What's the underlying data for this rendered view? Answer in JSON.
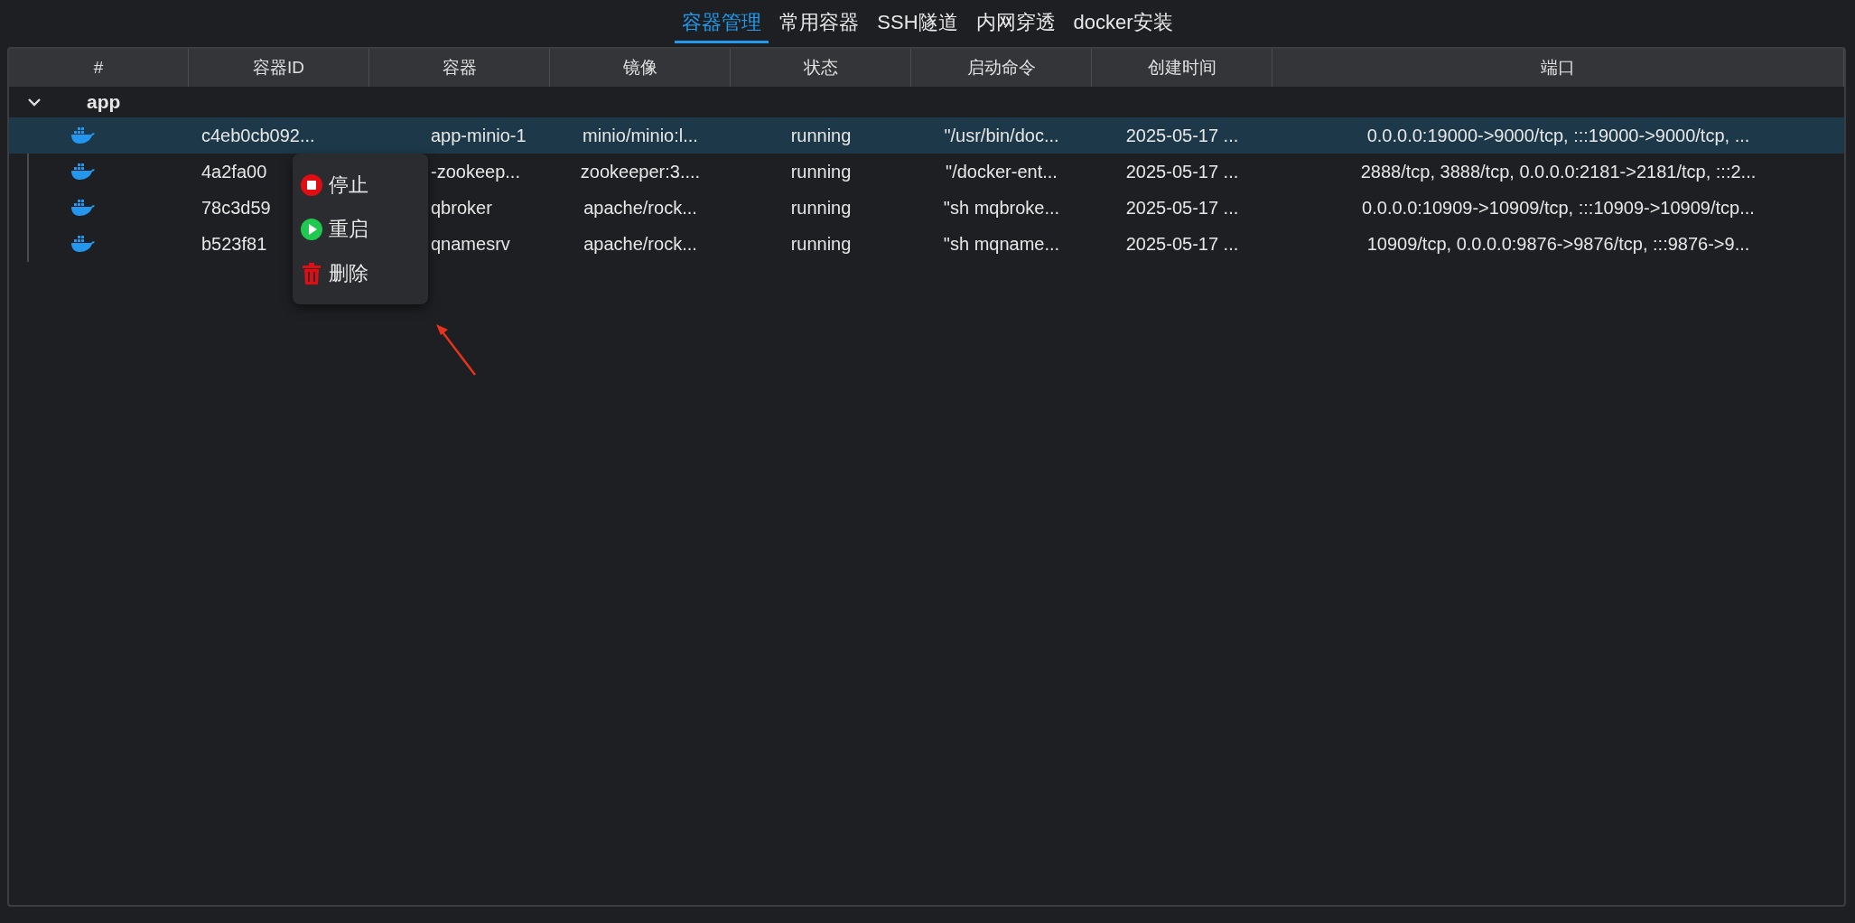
{
  "tabs": [
    {
      "label": "容器管理",
      "selected": true
    },
    {
      "label": "常用容器",
      "selected": false
    },
    {
      "label": "SSH隧道",
      "selected": false
    },
    {
      "label": "内网穿透",
      "selected": false
    },
    {
      "label": "docker安装",
      "selected": false
    }
  ],
  "table": {
    "columns": [
      "#",
      "容器ID",
      "容器",
      "镜像",
      "状态",
      "启动命令",
      "创建时间",
      "端口"
    ],
    "groups": [
      {
        "name": "app",
        "expanded": true,
        "rows": [
          {
            "selected": true,
            "cells": [
              "c4eb0cb092...",
              "app-minio-1",
              "minio/minio:l...",
              "running",
              "\"/usr/bin/doc...",
              "2025-05-17 ...",
              "0.0.0.0:19000->9000/tcp, :::19000->9000/tcp, ..."
            ]
          },
          {
            "selected": false,
            "cells": [
              "4a2fa00",
              "-zookeep...",
              "zookeeper:3....",
              "running",
              "\"/docker-ent...",
              "2025-05-17 ...",
              "2888/tcp, 3888/tcp, 0.0.0.0:2181->2181/tcp, :::2..."
            ]
          },
          {
            "selected": false,
            "cells": [
              "78c3d59",
              "qbroker",
              "apache/rock...",
              "running",
              "\"sh mqbroke...",
              "2025-05-17 ...",
              "0.0.0.0:10909->10909/tcp, :::10909->10909/tcp..."
            ]
          },
          {
            "selected": false,
            "cells": [
              "b523f81",
              "qnamesrv",
              "apache/rock...",
              "running",
              "\"sh mqname...",
              "2025-05-17 ...",
              "10909/tcp, 0.0.0.0:9876->9876/tcp, :::9876->9..."
            ]
          }
        ]
      }
    ]
  },
  "context_menu": {
    "items": [
      {
        "kind": "stop",
        "label": "停止"
      },
      {
        "kind": "restart",
        "label": "重启"
      },
      {
        "kind": "delete",
        "label": "删除"
      }
    ]
  }
}
